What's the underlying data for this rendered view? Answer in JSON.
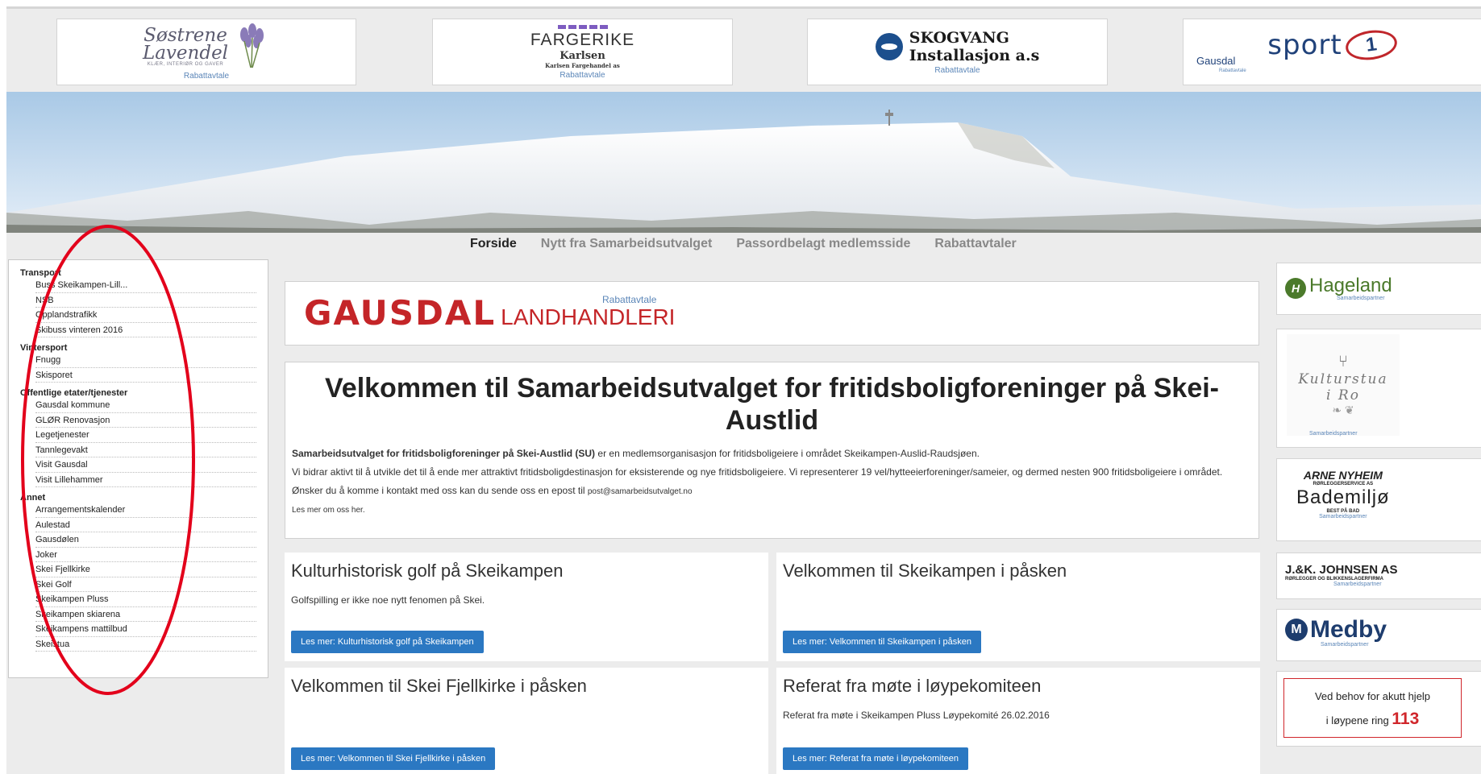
{
  "sponsors": [
    {
      "name_line1": "Søstrene",
      "name_line2": "Lavendel",
      "tagline": "KLÆR, INTERIØR OG GAVER",
      "label": "Rabattavtale"
    },
    {
      "name": "FARGERIKE",
      "line2": "Karlsen",
      "line3": "Karlsen Fargehandel as",
      "label": "Rabattavtale"
    },
    {
      "name_line1": "SKOGVANG",
      "name_line2": "Installasjon a.s",
      "label": "Rabattavtale"
    },
    {
      "name": "sport",
      "ring": "1",
      "place": "Gausdal",
      "label": "Rabattavtale"
    }
  ],
  "nav": {
    "items": [
      "Forside",
      "Nytt fra Samarbeidsutvalget",
      "Passordbelagt medlemsside",
      "Rabattavtaler"
    ],
    "active": "Forside"
  },
  "sidebar": {
    "groups": [
      {
        "title": "Transport",
        "items": [
          "Buss Skeikampen-Lill...",
          "NSB",
          "Opplandstrafikk",
          "Skibuss vinteren 2016"
        ]
      },
      {
        "title": "Vintersport",
        "items": [
          "Fnugg",
          "Skisporet"
        ]
      },
      {
        "title": "Offentlige etater/tjenester",
        "items": [
          "Gausdal kommune",
          "GLØR Renovasjon",
          "Legetjenester",
          "Tannlegevakt",
          "Visit Gausdal",
          "Visit Lillehammer"
        ]
      },
      {
        "title": "Annet",
        "items": [
          "Arrangementskalender",
          "Aulestad",
          "Gausdølen",
          "Joker",
          "Skei Fjellkirke",
          "Skei Golf",
          "Skeikampen Pluss",
          "Skeikampen skiarena",
          "Skeikampens mattilbud",
          "Skeistua"
        ]
      }
    ]
  },
  "promo": {
    "main": "GAUSDAL",
    "rest": "LANDHANDLERI",
    "label": "Rabattavtale"
  },
  "welcome": {
    "title": "Velkommen til Samarbeidsutvalget for fritidsboligforeninger på Skei-Austlid",
    "intro_bold": "Samarbeidsutvalget for fritidsboligforeninger på Skei-Austlid (SU)",
    "intro_rest": " er en medlemsorganisasjon for fritidsboligeiere i området Skeikampen-Auslid-Raudsjøen.",
    "para2": "Vi bidrar aktivt til å utvikle det til å ende mer attraktivt fritidsboligdestinasjon for eksisterende og nye fritidsboligeiere. Vi representerer 19 vel/hytteeierforeninger/sameier, og dermed nesten 900 fritidsboligeiere i området.",
    "contact_text": "Ønsker du å komme i kontakt med oss kan du sende oss en epost til ",
    "email": "post@samarbeidsutvalget.no",
    "more": "Les mer om oss her."
  },
  "cards": [
    {
      "title": "Kulturhistorisk golf på Skeikampen",
      "text": "Golfspilling er ikke noe nytt fenomen på Skei.",
      "button": "Les mer: Kulturhistorisk golf på Skeikampen"
    },
    {
      "title": "Velkommen til Skeikampen i påsken",
      "text": "",
      "button": "Les mer: Velkommen til Skeikampen i påsken"
    },
    {
      "title": "Velkommen til Skei Fjellkirke i påsken",
      "text": "",
      "button": "Les mer: Velkommen til Skei Fjellkirke i påsken"
    },
    {
      "title": "Referat fra møte i løypekomiteen",
      "text": "Referat fra møte i Skeikampen Pluss Løypekomité 26.02.2016",
      "button": "Les mer: Referat fra møte i løypekomiteen"
    }
  ],
  "partners": {
    "hageland": {
      "name": "Hageland",
      "label": "Samarbeidspartner"
    },
    "kulturstua": {
      "name_line1": "Kulturstua",
      "name_line2": "i Ro",
      "label": "Samarbeidspartner"
    },
    "arne": {
      "name": "ARNE NYHEIM",
      "tagline": "RØRLEGGERSERVICE AS",
      "brand": "Bademiljø",
      "brand_tag": "BEST PÅ BAD",
      "label": "Samarbeidspartner"
    },
    "jk": {
      "name": "J.&K. JOHNSEN AS",
      "tagline": "RØRLEGGER OG BLIKKENSLAGERFIRMA",
      "label": "Samarbeidspartner"
    },
    "medby": {
      "name": "Medby",
      "label": "Samarbeidspartner"
    }
  },
  "help": {
    "line1": "Ved behov for akutt hjelp",
    "line2": "i løypene ring ",
    "number": "113"
  },
  "colors": {
    "button": "#2b78c2",
    "accent_red": "#c42528",
    "annotation": "#e3001b",
    "link_blue": "#5b86b8"
  }
}
